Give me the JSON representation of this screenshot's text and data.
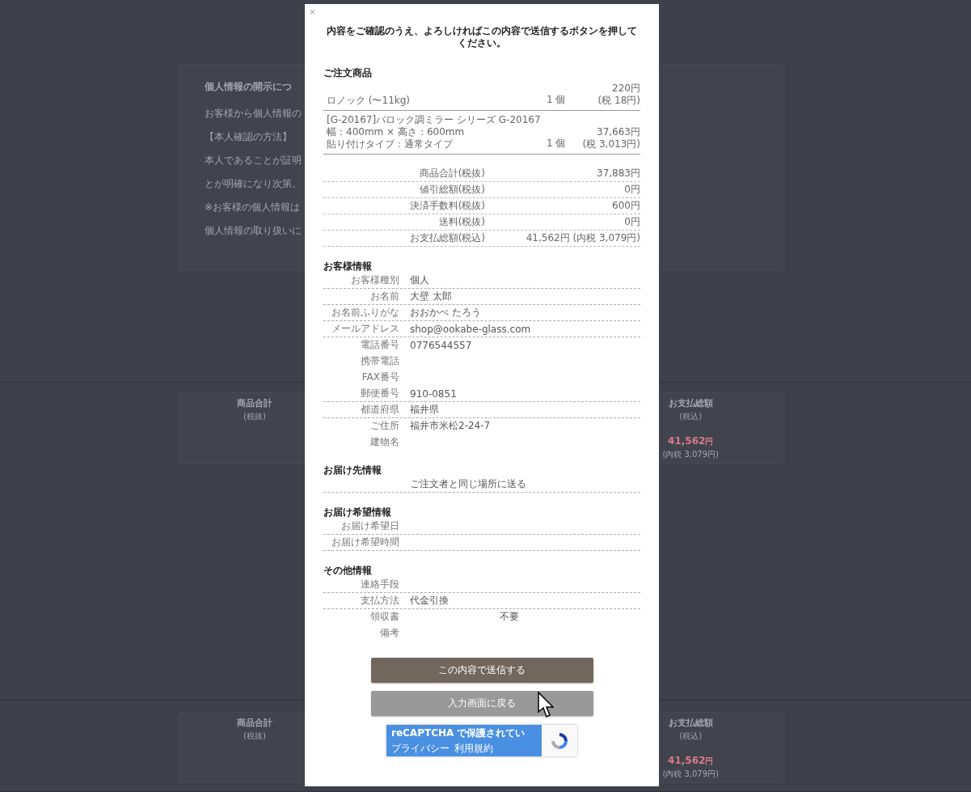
{
  "background": {
    "notice": {
      "title": "個人情報の開示につ",
      "lines": [
        "お客様から個人情報の",
        "【本人確認の方法】",
        "本人であることが証明",
        "とが明確になり次第、",
        "※お客様の個人情報は",
        "個人情報の取り扱いに"
      ]
    },
    "summaries": [
      {
        "left_label": "商品合計",
        "left_note": "(税抜)",
        "right_label": "お支払総額",
        "right_note": "(税込)",
        "total": "41,562",
        "yen": "円",
        "tax": "(内税 3,079円)"
      },
      {
        "left_label": "商品合計",
        "left_note": "(税抜)",
        "right_label": "お支払総額",
        "right_note": "(税込)",
        "total": "41,562",
        "yen": "円",
        "tax": "(内税 3,079円)"
      }
    ]
  },
  "modal": {
    "close": "×",
    "instruction": "内容をご確認のうえ、よろしければこの内容で送信するボタンを押してください。",
    "order": {
      "heading": "ご注文商品",
      "items": [
        {
          "lines": [
            "ロノック (〜11kg)"
          ],
          "qty": "1 個",
          "price": "220円",
          "tax": "(税 18円)"
        },
        {
          "lines": [
            "[G-20167]バロック調ミラー シリーズ G-20167",
            "幅：400mm × 高さ：600mm",
            "貼り付けタイプ：通常タイプ"
          ],
          "qty": "1 個",
          "price": "37,663円",
          "tax": "(税 3,013円)"
        }
      ],
      "totals": [
        {
          "label": "商品合計(税抜)",
          "value": "37,883円"
        },
        {
          "label": "値引総額(税抜)",
          "value": "0円"
        },
        {
          "label": "決済手数料(税抜)",
          "value": "600円"
        },
        {
          "label": "送料(税抜)",
          "value": "0円"
        },
        {
          "label": "お支払総額(税込)",
          "value": "41,562円 (内税 3,079円)"
        }
      ]
    },
    "sections": [
      {
        "heading": "お客様情報",
        "rows": [
          {
            "kind": "text",
            "label": "お客様種別",
            "value": "個人",
            "underline": true
          },
          {
            "kind": "text",
            "label": "お名前",
            "value": "大壁 太郎",
            "underline": true
          },
          {
            "kind": "text",
            "label": "お名前ふりがな",
            "value": "おおかべ たろう",
            "underline": true
          },
          {
            "kind": "text",
            "label": "メールアドレス",
            "value": "shop@ookabe-glass.com",
            "underline": true
          },
          {
            "kind": "text",
            "label": "電話番号",
            "value": "0776544557",
            "underline": false
          },
          {
            "kind": "text",
            "label": "携帯電話",
            "underline": false
          },
          {
            "kind": "text",
            "label": "FAX番号",
            "underline": false
          },
          {
            "kind": "text",
            "label": "郵便番号",
            "value": "910-0851",
            "underline": true
          },
          {
            "kind": "text",
            "label": "都道府県",
            "value": "福井県",
            "underline": true
          },
          {
            "kind": "text",
            "label": "ご住所",
            "value": "福井市米松2-24-7",
            "underline": false
          },
          {
            "kind": "text",
            "label": "建物名",
            "underline": false
          }
        ]
      },
      {
        "heading": "お届け先情報",
        "rows": [
          {
            "kind": "text",
            "value": "ご注文者と同じ場所に送る",
            "underline": true
          }
        ]
      },
      {
        "heading": "お届け希望情報",
        "rows": [
          {
            "kind": "text",
            "label": "お届け希望日",
            "underline": true
          },
          {
            "kind": "text",
            "label": "お届け希望時間",
            "underline": true
          }
        ]
      },
      {
        "heading": "その他情報",
        "rows": [
          {
            "kind": "text",
            "label": "連絡手段",
            "underline": true
          },
          {
            "kind": "text",
            "label": "支払方法",
            "value": "代金引換",
            "underline": true
          },
          {
            "kind": "option",
            "label": "領収書",
            "value": "不要",
            "underline": false
          },
          {
            "kind": "text",
            "label": "備考",
            "underline": false
          }
        ]
      }
    ],
    "buttons": [
      {
        "kind": "primary",
        "label": "この内容で送信する"
      },
      {
        "kind": "secondary",
        "label": "入力画面に戻る"
      }
    ],
    "recaptcha": {
      "text": "reCAPTCHA で保護されてい",
      "links": [
        "プライバシー",
        "利用規約"
      ]
    }
  }
}
